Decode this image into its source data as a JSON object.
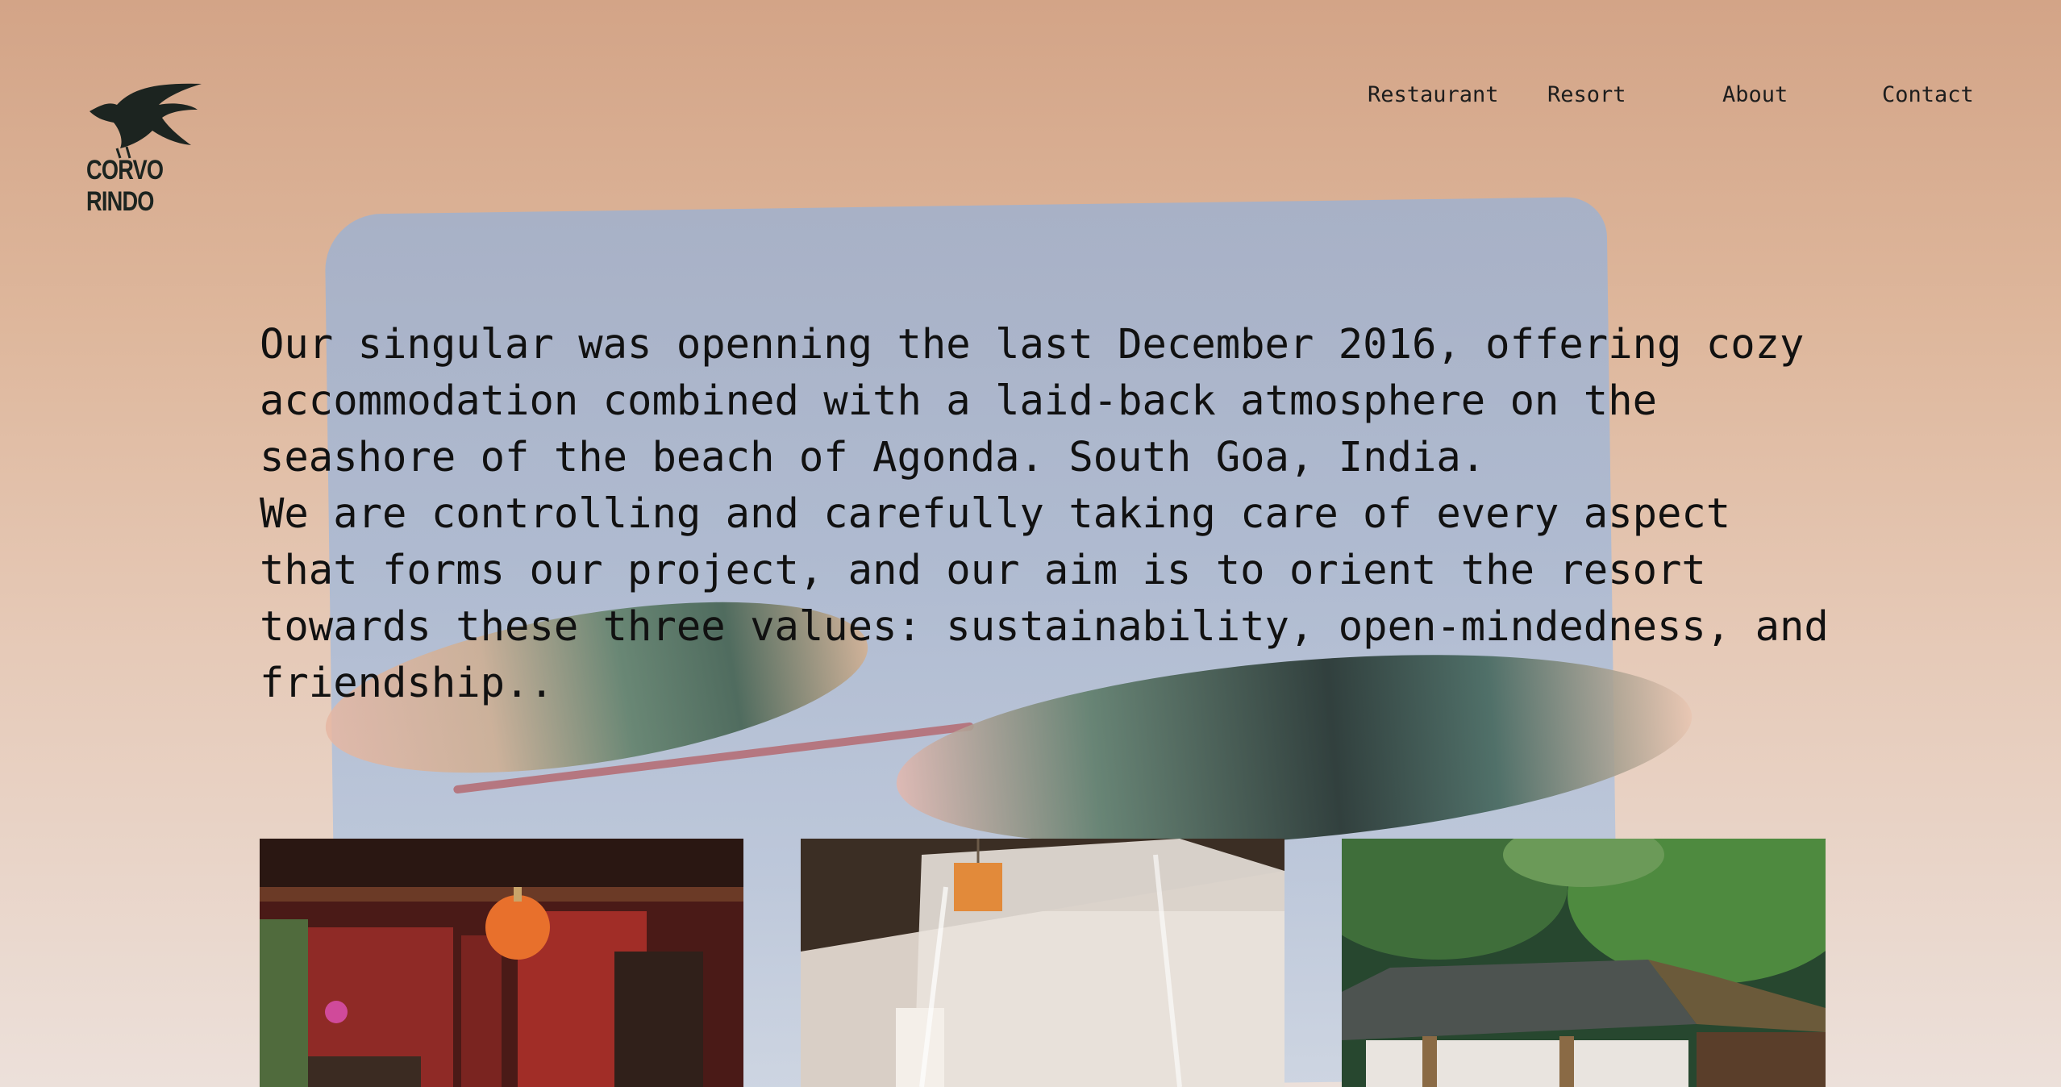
{
  "brand": {
    "name": "CORVO RINDO"
  },
  "nav": {
    "items": [
      "Restaurant",
      "Resort",
      "About",
      "Contact"
    ]
  },
  "intro": {
    "paragraph_1": "Our singular was openning the last December 2016, offering cozy accommodation combined with a laid-back atmosphere on the seashore of the beach of Agonda. South Goa, India.",
    "paragraph_2": "We are controlling and carefully taking care of every aspect that forms our project, and our aim is to orient the resort towards these three values: sustainability, open-mindedness, and friendship.."
  },
  "gallery": {
    "images": [
      "restaurant-interior-photo",
      "mosquito-net-bedroom-photo",
      "beach-hut-palms-photo"
    ]
  },
  "colors": {
    "background_top": "#d3a487",
    "background_bottom": "#ece0da",
    "paint_blue": "#a6b9d6",
    "text": "#111111",
    "logo": "#1c2420"
  }
}
